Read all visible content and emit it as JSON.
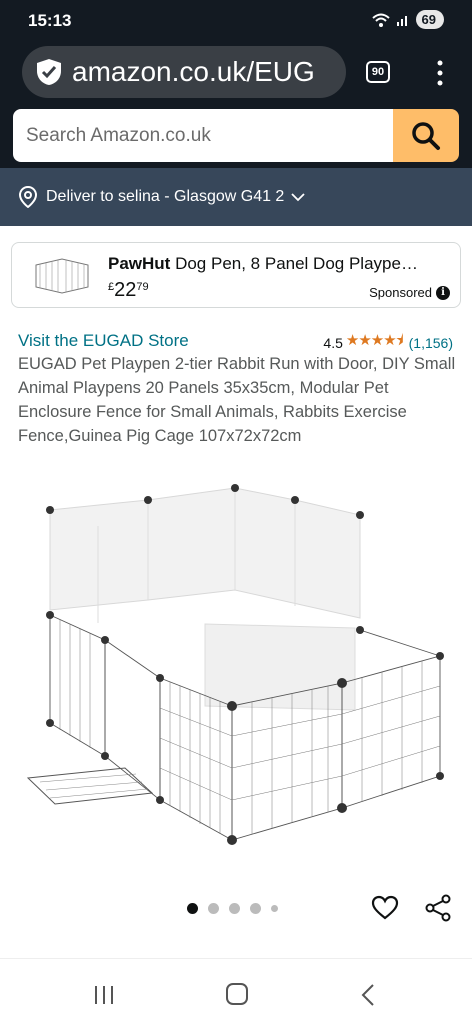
{
  "status": {
    "time": "15:13",
    "battery": "69"
  },
  "browser": {
    "url": "amazon.co.uk/EUG",
    "tab_count": "90"
  },
  "search": {
    "placeholder": "Search Amazon.co.uk"
  },
  "delivery": {
    "text": "Deliver to selina - Glasgow G41 2"
  },
  "ad": {
    "brand": "PawHut",
    "title": "Dog Pen, 8 Panel Dog Plaype…",
    "price_currency": "£",
    "price_whole": "22",
    "price_fraction": "79",
    "sponsored_label": "Sponsored"
  },
  "product": {
    "store_link": "Visit the EUGAD Store",
    "rating_value": "4.5",
    "rating_count": "(1,156)",
    "title": "EUGAD Pet Playpen 2-tier Rabbit Run with Door, DIY Small Animal Playpens 20 Panels 35x35cm, Modular Pet Enclosure Fence for Small Animals, Rabbits Exercise Fence,Guinea Pig Cage 107x72x72cm"
  },
  "carousel": {
    "total_dots": 5,
    "active_index": 0
  },
  "colors": {
    "header": "#131a22",
    "deliver_bar": "#37475a",
    "search_button": "#febd69",
    "link": "#007185",
    "star": "#de7921"
  }
}
